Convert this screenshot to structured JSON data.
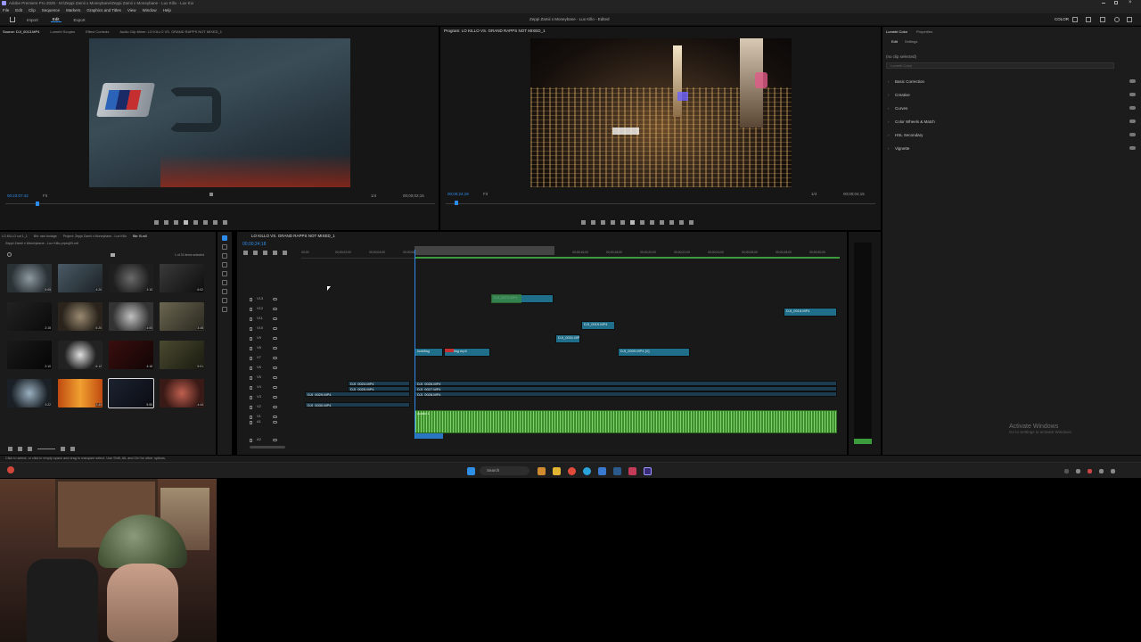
{
  "titlebar": {
    "app_title": "Adobe Premiere Pro 2025 - M:\\Zeppi Zamii x Moneybane\\Zeppi Zamii x Moneybane - Lux Killo - Lux Kio",
    "center_title": "Zeppi Zamii x Moneybane - Lux Killo - Edited"
  },
  "menubar": {
    "items": [
      "File",
      "Edit",
      "Clip",
      "Sequence",
      "Markers",
      "Graphics and Titles",
      "View",
      "Window",
      "Help"
    ]
  },
  "workspace_tabs": {
    "items": [
      "Import",
      "Edit",
      "Export"
    ],
    "active_index": 1,
    "right_label": "COLOR"
  },
  "source_monitor": {
    "tabs": [
      "Source: DJI_0013.MP4",
      "Lumetri Scopes",
      "Effect Controls",
      "Audio Clip Mixer: LO KILLO VS. GRAND RAPPS NOT MIXED_1"
    ],
    "timecode_left": "00:23:07:42",
    "fit": "Fit",
    "resolution": "1/4",
    "timecode_right": "00;00;02;15"
  },
  "program_monitor": {
    "title": "Program: LO KILLO VS. GRAND RAPPS NOT MIXED_1",
    "timecode_left": "00;00;24;18",
    "fit": "Fit",
    "resolution": "1/4",
    "timecode_right": "00;00;04;15"
  },
  "project_panel": {
    "tabs": [
      "LO KILLO cut 1_1",
      "Bin: raw footage",
      "Project: Zeppi Zamii x Moneybane - Lux Killo",
      "Bin: B-roll"
    ],
    "path": "Zeppi Zamii x Moneybane - Lux Killo.prproj\\B-roll",
    "items_count": "1 of 31 items selected",
    "thumbnails": [
      {
        "name": "DJI_0024.MP4",
        "dur": "5:05"
      },
      {
        "name": "DJI_0027.MP4",
        "dur": "4:20"
      },
      {
        "name": "DJI_0029.MP4",
        "dur": "3:10"
      },
      {
        "name": "DJI_0031.MP4",
        "dur": "6:02"
      },
      {
        "name": "DJI_0033.MP4",
        "dur": "2:15"
      },
      {
        "name": "DJI_0035.MP4",
        "dur": "5:20"
      },
      {
        "name": "DJI_0037.MP4",
        "dur": "4:00"
      },
      {
        "name": "DJI_0039.MP4",
        "dur": "3:45"
      },
      {
        "name": "DJI_0041.MP4",
        "dur": "2:10"
      },
      {
        "name": "DJI_0043.MP4",
        "dur": "6:12"
      },
      {
        "name": "DJI_0045.MP4",
        "dur": "4:18"
      },
      {
        "name": "DJI_0047.MP4",
        "dur": "5:01"
      },
      {
        "name": "DJI_0049.MP4",
        "dur": "3:22"
      },
      {
        "name": "DJI_0051.MP4",
        "dur": "2:40"
      },
      {
        "name": "DJI_0053.MP4",
        "dur": "5:55"
      },
      {
        "name": "DJI_0055.MP4",
        "dur": "4:44"
      }
    ]
  },
  "timeline": {
    "tab": "LO KILLO VS. GRAND RAPPS NOT MIXED_1",
    "timecode": "00;00;24;18",
    "ruler": [
      "00;00",
      "00;00;02;00",
      "00;00;04;00",
      "00;00;06;00",
      "00;00;08;00",
      "00;00;10;00",
      "00;00;12;00",
      "00;00;14;00",
      "00;00;16;00",
      "00;00;18;00",
      "00;00;20;00",
      "00;00;22;00",
      "00;00;24;00",
      "00;00;26;00",
      "00;00;28;00",
      "00;00;30;00"
    ],
    "video_tracks": [
      "V13",
      "V12",
      "V11",
      "V10",
      "V9",
      "V8",
      "V7",
      "V6",
      "V5",
      "V4",
      "V3",
      "V2",
      "V1"
    ],
    "audio_tracks": [
      "A1",
      "A2"
    ],
    "clips": [
      {
        "label": "DJI_0070.MP4"
      },
      {
        "label": "DJI_0018.MP4"
      },
      {
        "label": "DJI_0015.MP4"
      },
      {
        "label": "DJI_0031.MP4"
      },
      {
        "label": "lookflag"
      },
      {
        "label": "lookflag.mp4"
      },
      {
        "label": "DJI_0009.MP4 [V]"
      },
      {
        "label": "DJI_0024.MP4"
      },
      {
        "label": "DJI_0025.MP4"
      },
      {
        "label": "DJI_0026.MP4"
      },
      {
        "label": "DJI_0027.MP4"
      },
      {
        "label": "DJI_0028.MP4"
      },
      {
        "label": "DJI_0029.MP4"
      },
      {
        "label": "DJI_0030.MP4"
      }
    ],
    "audio_label": "Audio 1"
  },
  "lumetri": {
    "tabs": [
      "Lumetri Color",
      "Properties"
    ],
    "sub_tabs": [
      "Edit",
      "Settings"
    ],
    "no_clip": "(no clip selected)",
    "lut_placeholder": "Lumetri Color",
    "sections": [
      "Basic Correction",
      "Creative",
      "Curves",
      "Color Wheels & Match",
      "HSL Secondary",
      "Vignette"
    ]
  },
  "status_bar": {
    "hint": "Click to select, or click in empty space and drag to marquee select. Use Shift, Alt, and Ctrl for other options."
  },
  "watermark": {
    "line1": "Activate Windows",
    "line2": "Go to Settings to activate Windows."
  },
  "taskbar": {
    "search": "Search"
  },
  "colors": {
    "accent_blue": "#2d8ceb",
    "clip_teal": "#1f6f8b",
    "clip_green": "#3c8a3a",
    "audio_green": "#3f8e2e",
    "panel_bg": "#1d1d1d"
  }
}
